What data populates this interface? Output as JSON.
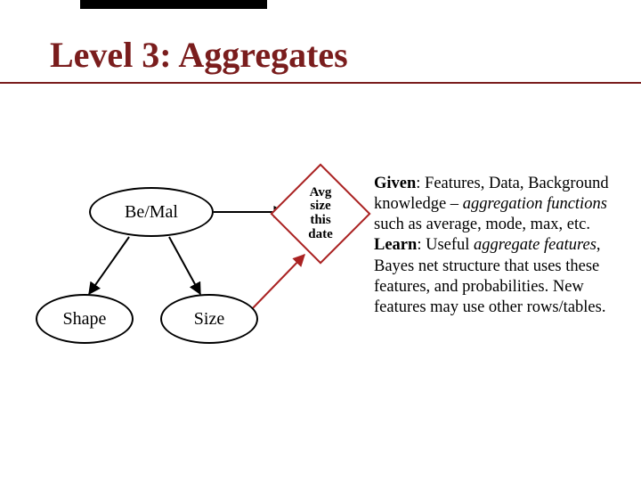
{
  "title": "Level 3: Aggregates",
  "nodes": {
    "bemal": "Be/Mal",
    "shape": "Shape",
    "size": "Size"
  },
  "aggregate_node": "Avg\nsize\nthis\ndate",
  "desc": {
    "given_label": "Given",
    "given_text": ": Features, Data, Background knowledge – ",
    "given_em": "aggregation functions",
    "given_tail": " such as average, mode, max, etc.",
    "learn_label": "Learn",
    "learn_text": ": Useful ",
    "learn_em1": "aggregate features",
    "learn_mid": ", Bayes net structure that uses these features, and probabilities.  New features may use other rows/tables."
  }
}
